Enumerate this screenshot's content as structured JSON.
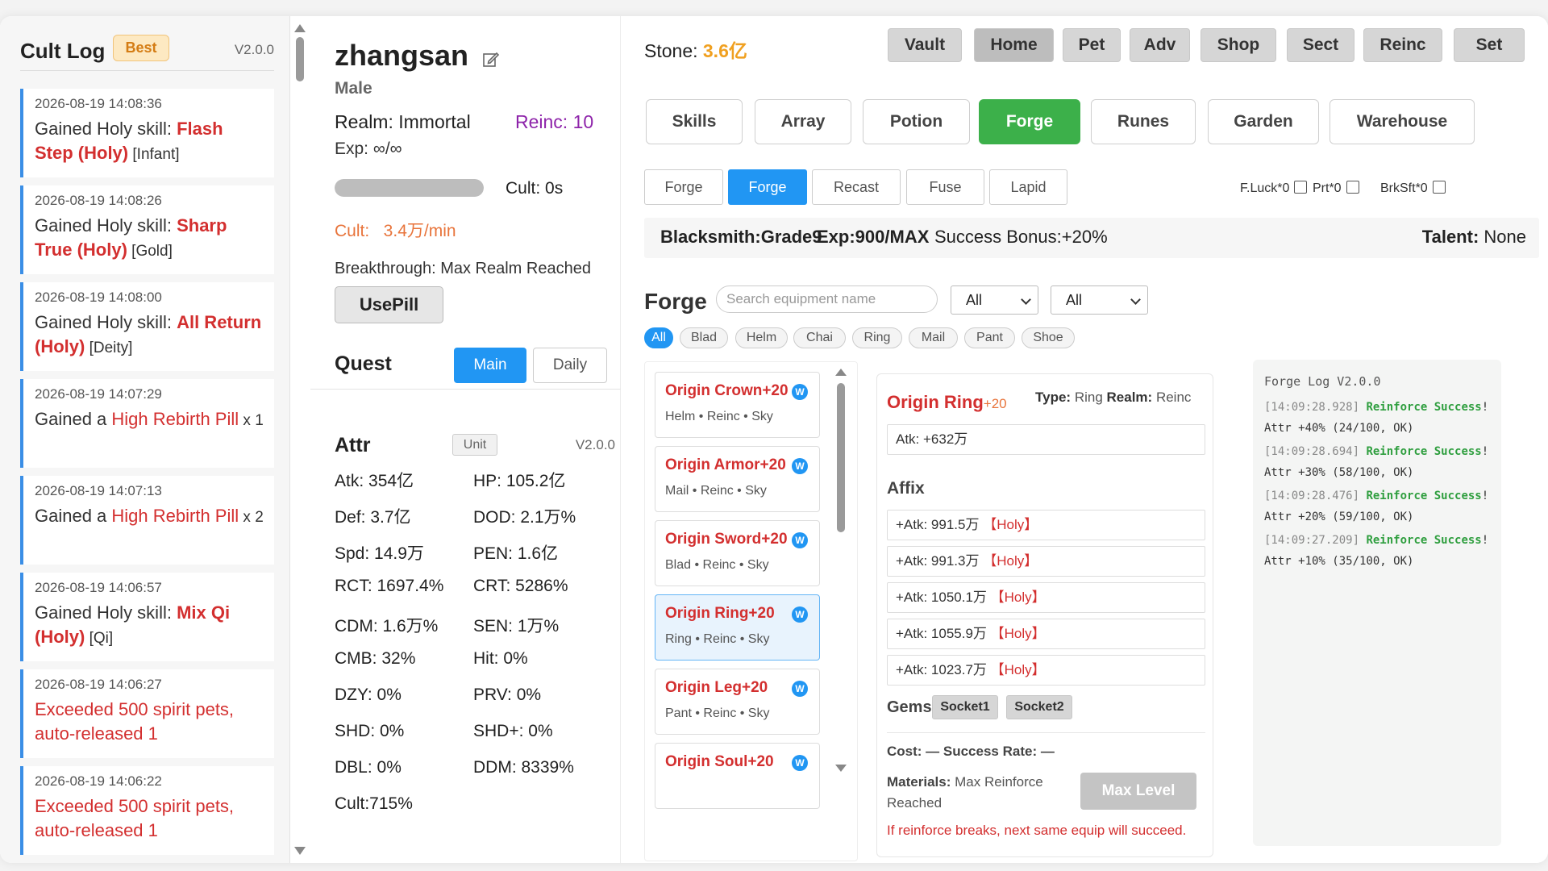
{
  "log_panel": {
    "title": "Cult Log",
    "badge": "Best",
    "version": "V2.0.0",
    "entries": [
      {
        "time": "2026-08-19 14:08:36",
        "prefix": "Gained Holy skill: ",
        "highlight": "Flash Step (Holy)",
        "suffix": "[Infant]"
      },
      {
        "time": "2026-08-19 14:08:26",
        "prefix": "Gained Holy skill: ",
        "highlight": "Sharp True (Holy)",
        "suffix": "[Gold]"
      },
      {
        "time": "2026-08-19 14:08:00",
        "prefix": "Gained Holy skill: ",
        "highlight": "All Return (Holy)",
        "suffix": "[Deity]"
      },
      {
        "time": "2026-08-19 14:07:29",
        "prefix": "Gained a ",
        "highlight": "High Rebirth Pill",
        "suffix": " x 1"
      },
      {
        "time": "2026-08-19 14:07:13",
        "prefix": "Gained a ",
        "highlight": "High Rebirth Pill",
        "suffix": " x 2"
      },
      {
        "time": "2026-08-19 14:06:57",
        "prefix": "Gained Holy skill: ",
        "highlight": "Mix Qi (Holy)",
        "suffix": "[Qi]"
      },
      {
        "time": "2026-08-19 14:06:27",
        "prefix": "",
        "highlight": "Exceeded 500 spirit pets, auto-released 1",
        "suffix": ""
      },
      {
        "time": "2026-08-19 14:06:22",
        "prefix": "",
        "highlight": "Exceeded 500 spirit pets, auto-released 1",
        "suffix": ""
      }
    ]
  },
  "character": {
    "name": "zhangsan",
    "gender": "Male",
    "realm": "Realm: Immortal",
    "reinc": "Reinc: 10",
    "exp": "Exp: ∞/∞",
    "cult_progress": 1.0,
    "cult_time": "Cult: 0s",
    "cult_rate": "Cult:   3.4万/min",
    "breakthrough": "Breakthrough: Max Realm Reached",
    "use_pill": "UsePill"
  },
  "quest": {
    "label": "Quest",
    "main": "Main",
    "daily": "Daily"
  },
  "attr": {
    "label": "Attr",
    "unit": "Unit",
    "version": "V2.0.0",
    "items": [
      "Atk: 354亿",
      "HP: 105.2亿",
      "Def: 3.7亿",
      "DOD: 2.1万%",
      "Spd: 14.9万",
      "PEN: 1.6亿",
      "RCT: 1697.4%",
      "CRT: 5286%",
      "CDM: 1.6万%",
      "SEN: 1万%",
      "CMB: 32%",
      "Hit: 0%",
      "DZY: 0%",
      "PRV: 0%",
      "SHD: 0%",
      "SHD+: 0%",
      "DBL: 0%",
      "DDM: 8339%",
      "Cult:715%"
    ]
  },
  "topbar": {
    "stone_label": "Stone: ",
    "stone_value": "3.6亿",
    "nav": [
      "Vault",
      "Home",
      "Pet",
      "Adv",
      "Shop",
      "Sect",
      "Reinc",
      "Set"
    ],
    "active_nav": "Home"
  },
  "subnav": {
    "items": [
      "Skills",
      "Array",
      "Potion",
      "Forge",
      "Runes",
      "Garden",
      "Warehouse"
    ],
    "active": "Forge"
  },
  "forge": {
    "tabs": [
      "Forge",
      "Forge",
      "Recast",
      "Fuse",
      "Lapid"
    ],
    "active_tab_index": 1,
    "checks": [
      "F.Luck*0",
      "Prt*0",
      "BrkSft*0"
    ],
    "blacksmith": "Blacksmith:Grade9",
    "exp": "Exp:900/MAX",
    "success_bonus": "Success Bonus:+20%",
    "talent_label": "Talent:",
    "talent_value": "None",
    "title": "Forge",
    "search_placeholder": "Search equipment name",
    "filter1": "All",
    "filter2": "All",
    "chips": [
      "All",
      "Blad",
      "Helm",
      "Chai",
      "Ring",
      "Mail",
      "Pant",
      "Shoe"
    ],
    "equipment": [
      {
        "name": "Origin Crown+20",
        "meta": "Helm • Reinc • Sky"
      },
      {
        "name": "Origin Armor+20",
        "meta": "Mail • Reinc • Sky"
      },
      {
        "name": "Origin Sword+20",
        "meta": "Blad • Reinc • Sky"
      },
      {
        "name": "Origin Ring+20",
        "meta": "Ring • Reinc • Sky"
      },
      {
        "name": "Origin Leg+20",
        "meta": "Pant • Reinc • Sky"
      },
      {
        "name": "Origin Soul+20",
        "meta": ""
      }
    ],
    "selected_index": 3,
    "detail": {
      "name": "Origin Ring",
      "level": "+20",
      "type_label": "Type:",
      "type_value": "Ring",
      "realm_label": "Realm:",
      "realm_value": "Reinc",
      "base": "Atk: +632万",
      "affix_title": "Affix",
      "affixes": [
        {
          "stat": "+Atk: 991.5万",
          "tag": "【Holy】"
        },
        {
          "stat": "+Atk: 991.3万",
          "tag": "【Holy】"
        },
        {
          "stat": "+Atk: 1050.1万",
          "tag": "【Holy】"
        },
        {
          "stat": "+Atk: 1055.9万",
          "tag": "【Holy】"
        },
        {
          "stat": "+Atk: 1023.7万",
          "tag": "【Holy】"
        }
      ],
      "gems_label": "Gems",
      "sockets": [
        "Socket1",
        "Socket2"
      ],
      "cost_line": "Cost: — Success Rate: —",
      "materials_label": "Materials:",
      "materials_value": "Max Reinforce Reached",
      "max_level_btn": "Max Level",
      "break_note": "If reinforce breaks, next same equip will succeed."
    },
    "log": {
      "title": "Forge Log V2.0.0",
      "entries": [
        {
          "time": "[14:09:28.928]",
          "result": "Reinforce Success",
          "detail": "! Attr +40% (24/100, OK)"
        },
        {
          "time": "[14:09:28.694]",
          "result": "Reinforce Success",
          "detail": "! Attr +30% (58/100, OK)"
        },
        {
          "time": "[14:09:28.476]",
          "result": "Reinforce Success",
          "detail": "! Attr +20% (59/100, OK)"
        },
        {
          "time": "[14:09:27.209]",
          "result": "Reinforce Success",
          "detail": "! Attr +10% (35/100, OK)"
        }
      ]
    }
  }
}
